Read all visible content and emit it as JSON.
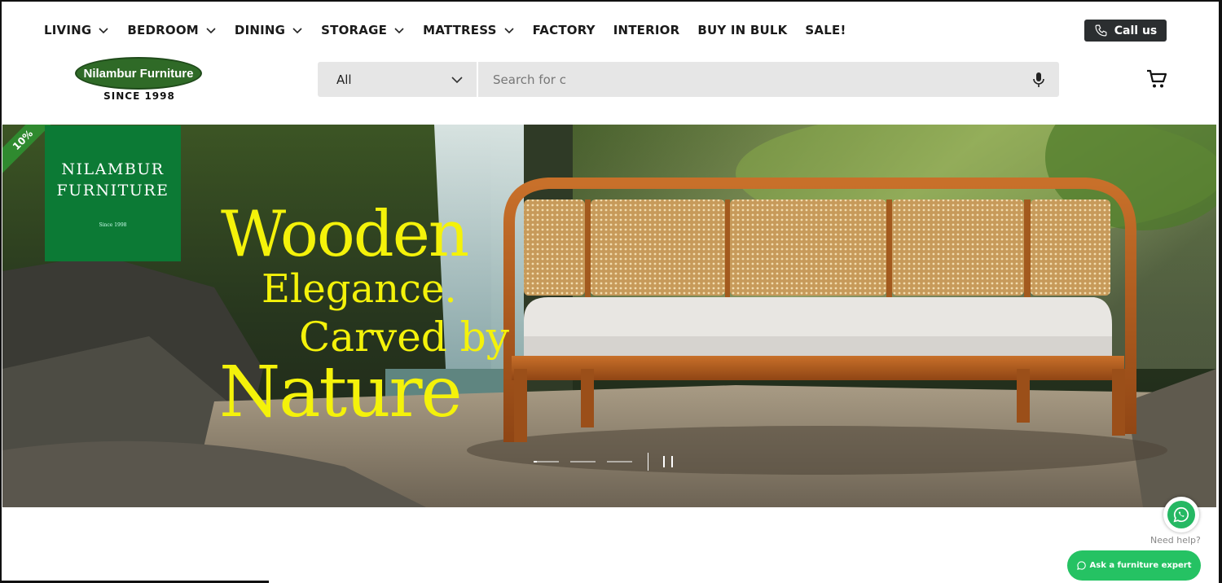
{
  "nav": {
    "items": [
      {
        "label": "LIVING",
        "dropdown": true
      },
      {
        "label": "BEDROOM",
        "dropdown": true
      },
      {
        "label": "DINING",
        "dropdown": true
      },
      {
        "label": "STORAGE",
        "dropdown": true
      },
      {
        "label": "MATTRESS",
        "dropdown": true
      },
      {
        "label": "FACTORY",
        "dropdown": false
      },
      {
        "label": "INTERIOR",
        "dropdown": false
      },
      {
        "label": "BUY IN BULK",
        "dropdown": false
      },
      {
        "label": "SALE!",
        "dropdown": false
      }
    ],
    "call_label": "Call us"
  },
  "logo": {
    "name": "Nilambur Furniture",
    "since": "SINCE 1998"
  },
  "search": {
    "category": "All",
    "placeholder": "Search for c"
  },
  "hero": {
    "ribbon": "10%",
    "brand_line1": "NILAMBUR",
    "brand_line2": "FURNITURE",
    "brand_since": "Since 1998",
    "tagline_1": "Wooden",
    "tagline_2": "Elegance.",
    "tagline_3": "Carved by",
    "tagline_4": "Nature",
    "slide_count": 3,
    "active_slide": 1
  },
  "help": {
    "need_help": "Need help?",
    "ask_label": "Ask a furniture expert"
  },
  "colors": {
    "brand_green": "#0c7a35",
    "logo_green": "#2f6a27",
    "tagline_yellow": "#f4f20a",
    "whatsapp_green": "#25c263",
    "call_button": "#2b2e30"
  }
}
